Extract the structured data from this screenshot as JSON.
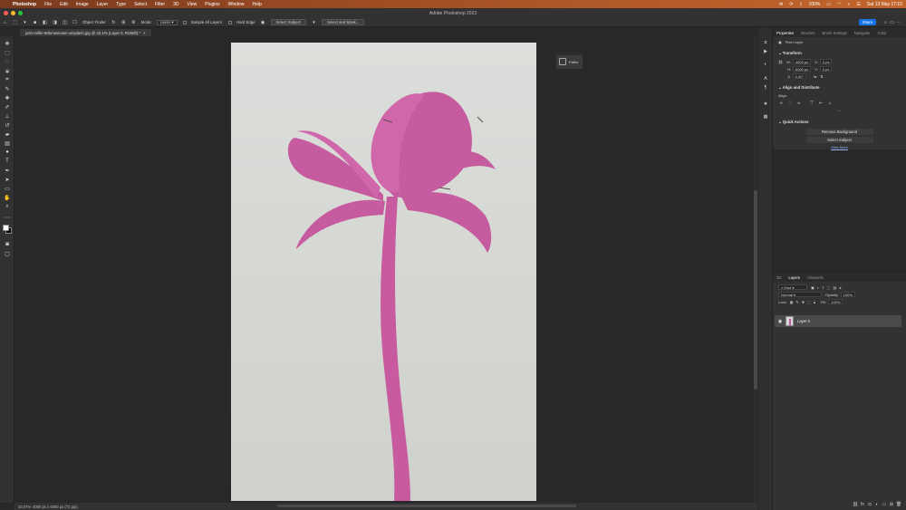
{
  "menubar": {
    "app": "Photoshop",
    "items": [
      "File",
      "Edit",
      "Image",
      "Layer",
      "Type",
      "Select",
      "Filter",
      "3D",
      "View",
      "Plugins",
      "Window",
      "Help"
    ],
    "battery": "100%",
    "datetime": "Sat 13 May  17:15"
  },
  "window": {
    "title": "Adobe Photoshop 2023"
  },
  "options": {
    "object_finder": "Object Finder",
    "mode_label": "Mode:",
    "mode_value": "Lasso",
    "sample_all_layers": "Sample All Layers",
    "hard_edge": "Hard Edge",
    "select_subject": "Select Subject",
    "select_and_mask": "Select and Mask...",
    "share": "Share"
  },
  "document": {
    "tab": "josh-miller-9dnmwmowv-unsplash.jpg @ 43.1% (Layer 0, RGB/8) *",
    "zoom": "43.07%",
    "doc_info": "4000 px x 6000 px (72 ppi)"
  },
  "floating_panel": {
    "label": "Paths"
  },
  "properties": {
    "tabs": [
      "Properties",
      "Brushes",
      "Brush Settings",
      "Navigator",
      "Color"
    ],
    "active_tab": "Properties",
    "layer_type": "Pixel Layer",
    "transform_title": "Transform",
    "w": "4000 px",
    "h": "6000 px",
    "x": "0 px",
    "y": "0 px",
    "angle": "0.00°",
    "align_title": "Align and Distribute",
    "align_label": "Align:",
    "quick_actions_title": "Quick Actions",
    "remove_background": "Remove Background",
    "select_subject": "Select Subject",
    "view_more": "View More"
  },
  "layers": {
    "tabs": [
      "3D",
      "Layers",
      "Channels"
    ],
    "active_tab": "Layers",
    "filter_kind": "Kind",
    "blend_mode": "Normal",
    "opacity_label": "Opacity:",
    "opacity": "100%",
    "lock_label": "Lock:",
    "fill_label": "Fill:",
    "fill": "100%",
    "layer_name": "Layer 0"
  },
  "colors": {
    "accent": "#1473e6",
    "overlay": "#c85aa0"
  }
}
